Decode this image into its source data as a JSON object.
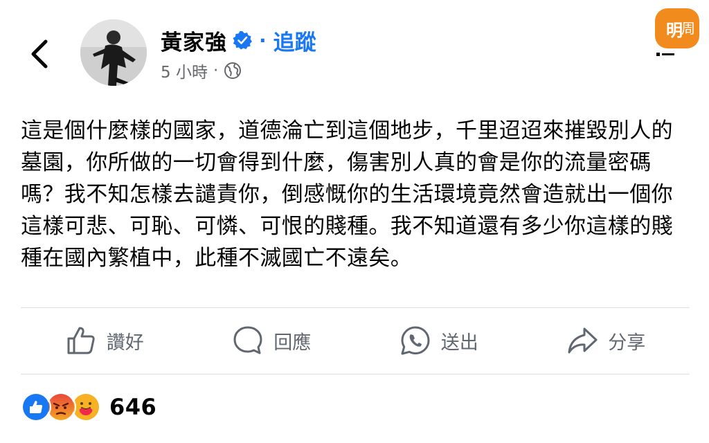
{
  "post": {
    "author_name": "黃家強",
    "separator": "·",
    "follow_label": "追蹤",
    "timestamp": "5 小時",
    "meta_separator": "·",
    "body": "這是個什麼樣的國家，道德淪亡到這個地步，千里迢迢來摧毀別人的墓園，你所做的一切會得到什麼，傷害別人真的會是你的流量密碼嗎？我不知怎樣去譴責你，倒感慨你的生活環境竟然會造就出一個你這樣可悲、可恥、可憐、可恨的賤種。我不知道還有多少你這樣的賤種在國內繁植中，此種不滅國亡不遠矣。"
  },
  "logo": {
    "text_1": "明",
    "text_2": "周"
  },
  "actions": [
    {
      "label": "讚好",
      "icon": "like-icon"
    },
    {
      "label": "回應",
      "icon": "comment-icon"
    },
    {
      "label": "送出",
      "icon": "whatsapp-icon"
    },
    {
      "label": "分享",
      "icon": "share-icon"
    }
  ],
  "reactions": {
    "icons": [
      "like-reaction",
      "angry-reaction",
      "care-reaction"
    ],
    "count": "646"
  },
  "colors": {
    "accent": "#1877f2",
    "secondary_text": "#65676b",
    "logo_orange": "#f28b1e"
  }
}
